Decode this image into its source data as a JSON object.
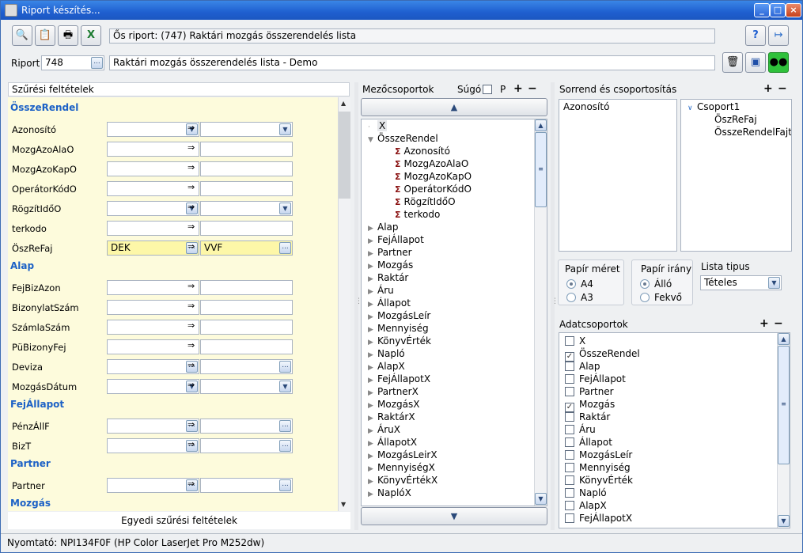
{
  "window": {
    "title": "Riport készítés...",
    "min": "_",
    "max": "□",
    "close": "×"
  },
  "toolbar": {
    "icons": [
      "preview-icon",
      "clipboard-icon",
      "printer-icon",
      "excel-icon"
    ],
    "help": "?",
    "exit": "↦",
    "delete": "🗑",
    "save": "💾",
    "users": "👥"
  },
  "origin": {
    "label": "Ős riport:",
    "value": "(747)  Raktári mozgás összerendelés lista"
  },
  "report": {
    "label": "Riport",
    "id": "748",
    "browse": "...",
    "name": "Raktári mozgás összerendelés lista - Demo"
  },
  "filters": {
    "header": "Szűrési feltételek",
    "footer": "Egyedi szűrési feltételek",
    "arrow": "⇒",
    "sections": [
      {
        "title": "ÖsszeRendel",
        "rows": [
          {
            "label": "Azonosító",
            "type": "dd",
            "from": "",
            "to": ""
          },
          {
            "label": "MozgAzoAlaO",
            "type": "txt",
            "from": "",
            "to": ""
          },
          {
            "label": "MozgAzoKapO",
            "type": "txt",
            "from": "",
            "to": ""
          },
          {
            "label": "OperátorKódO",
            "type": "txt",
            "from": "",
            "to": ""
          },
          {
            "label": "RögzítIdőO",
            "type": "dd",
            "from": "",
            "to": ""
          },
          {
            "label": "terkodo",
            "type": "txt",
            "from": "",
            "to": ""
          },
          {
            "label": "ÖszReFaj",
            "type": "btn",
            "from": "DEK",
            "to": "VVF",
            "yellow": true
          }
        ]
      },
      {
        "title": "Alap",
        "rows": [
          {
            "label": "FejBizAzon",
            "type": "txt",
            "from": "",
            "to": ""
          },
          {
            "label": "BizonylatSzám",
            "type": "txt",
            "from": "",
            "to": ""
          },
          {
            "label": "SzámlaSzám",
            "type": "txt",
            "from": "",
            "to": ""
          },
          {
            "label": "PüBizonyFej",
            "type": "txt",
            "from": "",
            "to": ""
          },
          {
            "label": "Deviza",
            "type": "btn",
            "from": "",
            "to": ""
          },
          {
            "label": "MozgásDátum",
            "type": "dd",
            "from": "",
            "to": ""
          }
        ]
      },
      {
        "title": "FejÁllapot",
        "rows": [
          {
            "label": "PénzÁllF",
            "type": "btn",
            "from": "",
            "to": ""
          },
          {
            "label": "BizT",
            "type": "btn",
            "from": "",
            "to": ""
          }
        ]
      },
      {
        "title": "Partner",
        "rows": [
          {
            "label": "Partner",
            "type": "btn",
            "from": "",
            "to": ""
          }
        ]
      },
      {
        "title": "Mozgás",
        "rows": []
      }
    ]
  },
  "fields": {
    "header": "Mezőcsoportok",
    "sugo": "Súgó",
    "p": "P",
    "plus": "+",
    "minus": "−",
    "items": [
      {
        "label": "X",
        "level": 0,
        "type": "x"
      },
      {
        "label": "ÖsszeRendel",
        "level": 0,
        "type": "open"
      },
      {
        "label": "Azonosító",
        "level": 1,
        "type": "sig"
      },
      {
        "label": "MozgAzoAlaO",
        "level": 1,
        "type": "sig"
      },
      {
        "label": "MozgAzoKapO",
        "level": 1,
        "type": "sig"
      },
      {
        "label": "OperátorKódO",
        "level": 1,
        "type": "sig"
      },
      {
        "label": "RögzítIdőO",
        "level": 1,
        "type": "sig"
      },
      {
        "label": "terkodo",
        "level": 1,
        "type": "sig"
      },
      {
        "label": "Alap",
        "level": 0,
        "type": "closed"
      },
      {
        "label": "FejÁllapot",
        "level": 0,
        "type": "closed"
      },
      {
        "label": "Partner",
        "level": 0,
        "type": "closed"
      },
      {
        "label": "Mozgás",
        "level": 0,
        "type": "closed"
      },
      {
        "label": "Raktár",
        "level": 0,
        "type": "closed"
      },
      {
        "label": "Áru",
        "level": 0,
        "type": "closed"
      },
      {
        "label": "Állapot",
        "level": 0,
        "type": "closed"
      },
      {
        "label": "MozgásLeír",
        "level": 0,
        "type": "closed"
      },
      {
        "label": "Mennyiség",
        "level": 0,
        "type": "closed"
      },
      {
        "label": "KönyvÉrték",
        "level": 0,
        "type": "closed"
      },
      {
        "label": "Napló",
        "level": 0,
        "type": "closed"
      },
      {
        "label": "AlapX",
        "level": 0,
        "type": "closed"
      },
      {
        "label": "FejÁllapotX",
        "level": 0,
        "type": "closed"
      },
      {
        "label": "PartnerX",
        "level": 0,
        "type": "closed"
      },
      {
        "label": "MozgásX",
        "level": 0,
        "type": "closed"
      },
      {
        "label": "RaktárX",
        "level": 0,
        "type": "closed"
      },
      {
        "label": "ÁruX",
        "level": 0,
        "type": "closed"
      },
      {
        "label": "ÁllapotX",
        "level": 0,
        "type": "closed"
      },
      {
        "label": "MozgásLeirX",
        "level": 0,
        "type": "closed"
      },
      {
        "label": "MennyiségX",
        "level": 0,
        "type": "closed"
      },
      {
        "label": "KönyvÉrtékX",
        "level": 0,
        "type": "closed"
      },
      {
        "label": "NaplóX",
        "level": 0,
        "type": "closed"
      }
    ]
  },
  "sort": {
    "header": "Sorrend és csoportosítás",
    "list": [
      "Azonosító"
    ],
    "group": "Csoport1",
    "group_items": [
      "ÖszReFaj",
      "ÖsszeRendelFajta"
    ]
  },
  "paper": {
    "size_title": "Papír méret",
    "sizes": [
      "A4",
      "A3"
    ],
    "size_selected": 0,
    "orient_title": "Papír irány",
    "orients": [
      "Álló",
      "Fekvő"
    ],
    "orient_selected": 0,
    "list_type_label": "Lista tipus",
    "list_type_value": "Tételes"
  },
  "data_groups": {
    "header": "Adatcsoportok",
    "items": [
      {
        "label": "X",
        "checked": false
      },
      {
        "label": "ÖsszeRendel",
        "checked": true
      },
      {
        "label": "Alap",
        "checked": false
      },
      {
        "label": "FejÁllapot",
        "checked": false
      },
      {
        "label": "Partner",
        "checked": false
      },
      {
        "label": "Mozgás",
        "checked": true
      },
      {
        "label": "Raktár",
        "checked": false
      },
      {
        "label": "Áru",
        "checked": false
      },
      {
        "label": "Állapot",
        "checked": false
      },
      {
        "label": "MozgásLeír",
        "checked": false
      },
      {
        "label": "Mennyiség",
        "checked": false
      },
      {
        "label": "KönyvÉrték",
        "checked": false
      },
      {
        "label": "Napló",
        "checked": false
      },
      {
        "label": "AlapX",
        "checked": false
      },
      {
        "label": "FejÁllapotX",
        "checked": false
      }
    ]
  },
  "status": {
    "printer": "Nyomtató: NPI134F0F (HP Color LaserJet Pro M252dw)"
  }
}
